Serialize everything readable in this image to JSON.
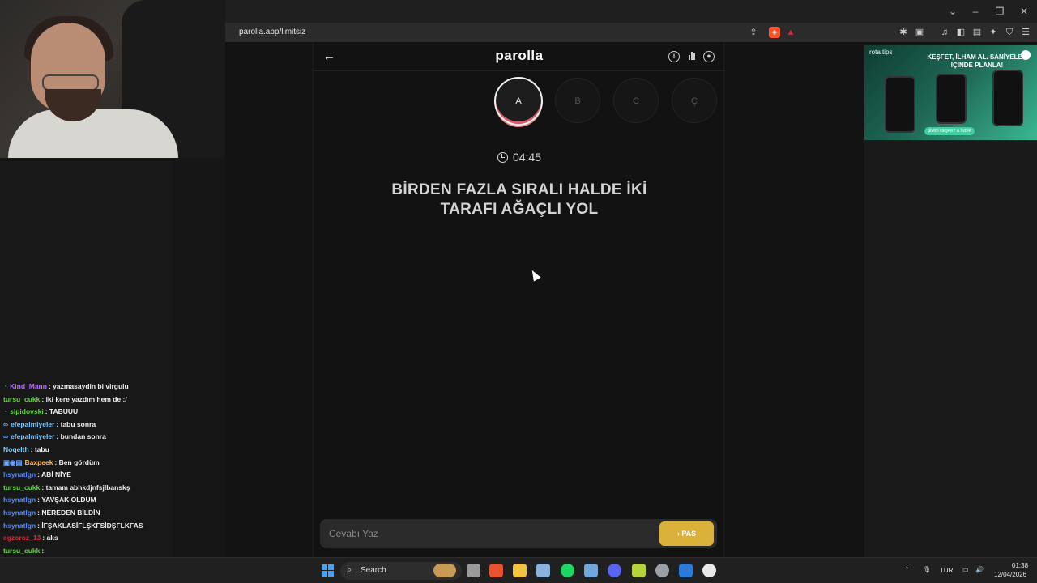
{
  "browser": {
    "url": "parolla.app/limitsiz"
  },
  "game": {
    "brand": "parolla",
    "letters": [
      "A",
      "B",
      "C",
      "Ç"
    ],
    "active_letter": "A",
    "timer": "04:45",
    "question": "BİRDEN FAZLA SIRALI HALDE İKİ TARAFI AĞAÇLI YOL",
    "answer_placeholder": "Cevabı Yaz",
    "pass_label": "PAS"
  },
  "ad": {
    "brand": "rota.tips",
    "headline": "KEŞFET, İLHAM AL. SANİYELER İÇİNDE PLANLA!",
    "cta": "ŞİMDİ KEŞFET & İNDİR"
  },
  "chat": [
    {
      "user": "Kind_Mann",
      "color": "#b56bff",
      "text": "yazmasaydin bi virgulu"
    },
    {
      "user": "tursu_cukk",
      "color": "#5ddc3a",
      "text": "iki kere yazdım hem de :/"
    },
    {
      "user": "sipidovski",
      "color": "#5ddc3a",
      "text": "TABUUU"
    },
    {
      "user": "efepalmiyeler",
      "color": "#7ec8ff",
      "text": "tabu sonra"
    },
    {
      "user": "efepalmiyeler",
      "color": "#7ec8ff",
      "text": "bundan sonra"
    },
    {
      "user": "Noqelth",
      "color": "#7fd0ff",
      "text": "tabu"
    },
    {
      "user": "Baxpeek",
      "color": "#ffb84d",
      "text": "Ben gördüm"
    },
    {
      "user": "hsynatlgn",
      "color": "#4d8cff",
      "text": "ABİ NİYE"
    },
    {
      "user": "tursu_cukk",
      "color": "#5ddc3a",
      "text": "tamam abhkdjnfsjlbanskş"
    },
    {
      "user": "hsynatlgn",
      "color": "#4d8cff",
      "text": "YAVŞAK OLDUM"
    },
    {
      "user": "hsynatlgn",
      "color": "#4d8cff",
      "text": "NEREDEN BİLDİN"
    },
    {
      "user": "hsynatlgn",
      "color": "#4d8cff",
      "text": "İFŞAKLASİFLŞKFSİDŞFLKFAS"
    },
    {
      "user": "egzoroz_13",
      "color": "#d02c3a",
      "text": "aks"
    },
    {
      "user": "tursu_cukk",
      "color": "#5ddc3a",
      "text": ""
    }
  ],
  "taskbar": {
    "search_label": "Search",
    "language": "TUR",
    "time": "01:38",
    "date": "12/04/2026"
  }
}
